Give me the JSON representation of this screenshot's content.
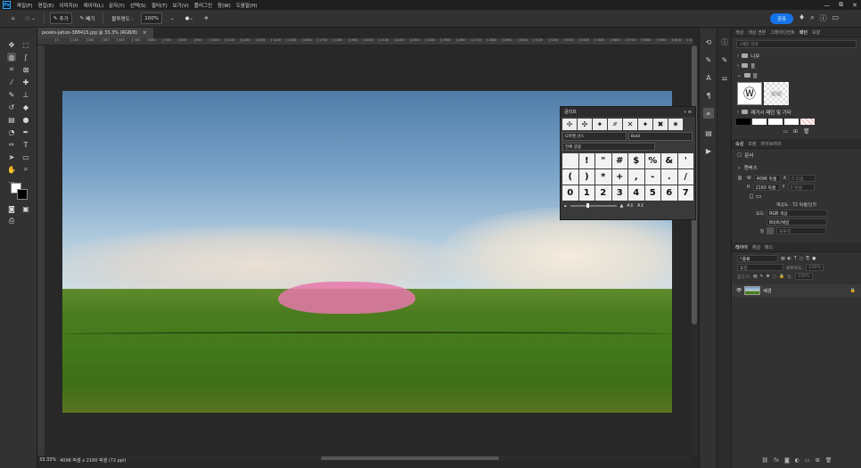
{
  "menu": {
    "items": [
      "파일(F)",
      "편집(E)",
      "이미지(I)",
      "레이어(L)",
      "문자(Y)",
      "선택(S)",
      "필터(T)",
      "보기(V)",
      "플러그인",
      "창(W)",
      "도움말(H)"
    ],
    "window_controls": [
      "—",
      "⧉",
      "✕"
    ]
  },
  "options": {
    "add_label": "추가",
    "subtract_label": "빼기",
    "opacity_label": "불투명도 :",
    "opacity_value": "100%"
  },
  "topbar": {
    "share_label": "공유"
  },
  "document": {
    "tab_title": "pexels-jahoo-388415.jpg @ 33.3% (RGB/8)",
    "tab_close": "×",
    "ruler_ticks": [
      "0",
      "100",
      "200",
      "300",
      "400",
      "500",
      "600",
      "700",
      "800",
      "900",
      "1000",
      "1100",
      "1200",
      "1300",
      "1400",
      "1500",
      "1600",
      "1700",
      "1800",
      "1900",
      "2000",
      "2100",
      "2200",
      "2300",
      "2400",
      "2500",
      "2600",
      "2700",
      "2800",
      "2900",
      "3000",
      "3100",
      "3200",
      "3300",
      "3400",
      "3500",
      "3600",
      "3700",
      "3800",
      "3900",
      "4000",
      "4100"
    ],
    "brush_stroke_color": "#e678aa"
  },
  "status": {
    "zoom": "33.33%",
    "info": "4096 픽셀 x 2160 픽셀 (72 ppi)"
  },
  "glyphs_panel": {
    "title": "글리프",
    "font_family": "G마켓 산스",
    "font_style": "Bold",
    "category": "전체 글꼴",
    "recent": [
      "✢",
      "✣",
      "✦",
      "⁄⁄⁄⁄",
      "✕",
      "✦",
      "✖",
      "✷"
    ],
    "glyphs": [
      "",
      "!",
      "\"",
      "#",
      "$",
      "%",
      "&",
      "'",
      "(",
      ")",
      "*",
      "+",
      ",",
      "-",
      ".",
      "/",
      "0",
      "1",
      "2",
      "3",
      "4",
      "5",
      "6",
      "7"
    ]
  },
  "patterns_panel": {
    "tabs": [
      "색상",
      "색상 견본",
      "그레이디언트",
      "패턴",
      "모양"
    ],
    "active_tab": "패턴",
    "search_placeholder": "패턴 검색",
    "folders": [
      "나무",
      "풀",
      "물",
      "레거시 패턴 및 기타"
    ],
    "swatch_colors": [
      "#000000",
      "#ffffff",
      "#ffffff",
      "#ffffff",
      "#f4c8c8"
    ]
  },
  "properties_panel": {
    "tabs": [
      "속성",
      "조정",
      "라이브러리"
    ],
    "active_tab": "속성",
    "doc_label": "문서",
    "canvas_title": "캔버스",
    "w_label": "W",
    "w_value": "4096 픽셀",
    "x_label": "X",
    "x_value": "0 픽셀",
    "h_label": "H",
    "h_value": "2160 픽셀",
    "y_label": "Y",
    "y_value": "0 픽셀",
    "resolution": "해상도 : 72 픽셀/인치",
    "mode_label": "모드",
    "mode_value": "RGB 색상",
    "depth_value": "8비트/채널",
    "fill_label": "칠",
    "fill_value": "불투명"
  },
  "layers_panel": {
    "tabs": [
      "레이어",
      "채널",
      "패스"
    ],
    "active_tab": "레이어",
    "filter_label": "종류",
    "blend_mode": "표준",
    "opacity_label": "불투명도:",
    "opacity_value": "100%",
    "lock_label": "잠그기:",
    "fill_label": "칠:",
    "fill_value": "100%",
    "layer_name": "배경"
  }
}
